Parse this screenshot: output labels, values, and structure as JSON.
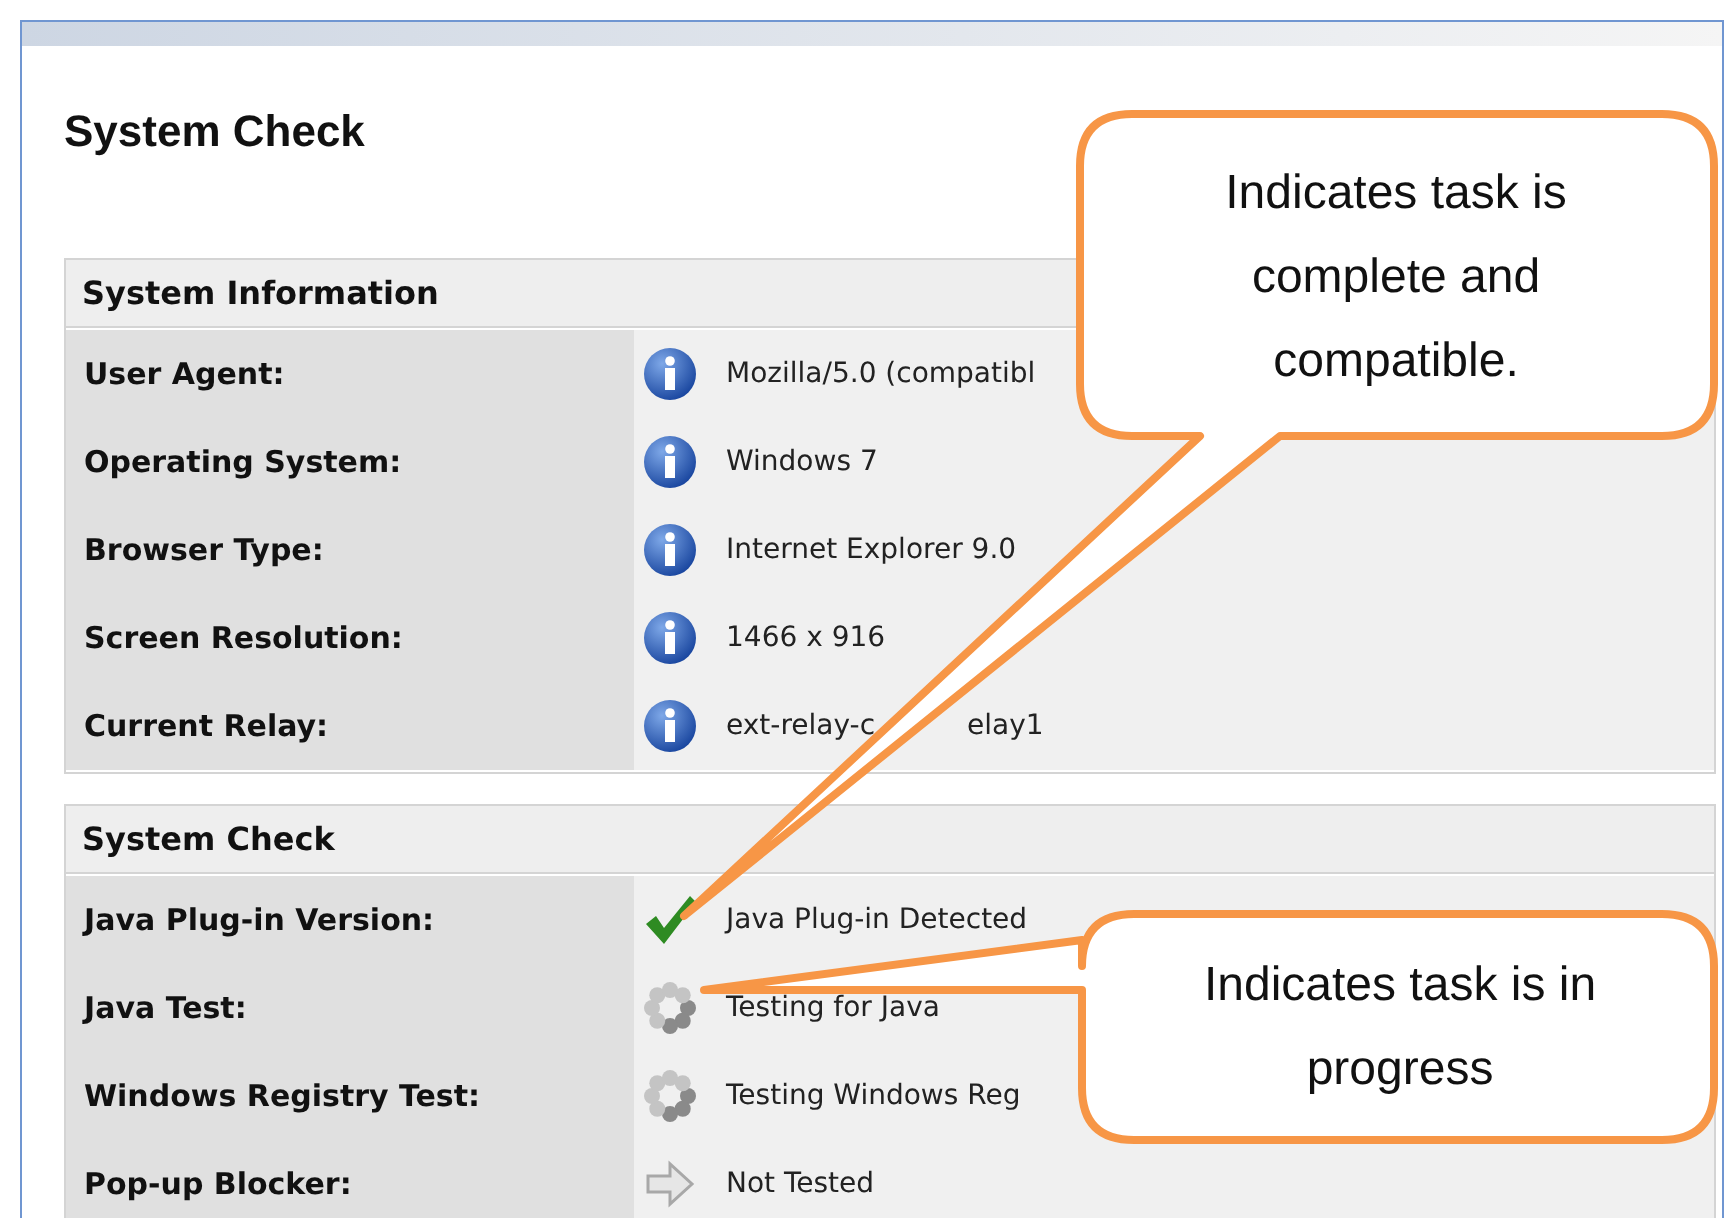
{
  "page": {
    "title": "System Check"
  },
  "sections": [
    {
      "heading": "System Information",
      "rows": [
        {
          "label": "User Agent:",
          "kind": "info",
          "value": "Mozilla/5.0 (compatibl"
        },
        {
          "label": "Operating System:",
          "kind": "info",
          "value": "Windows 7"
        },
        {
          "label": "Browser Type:",
          "kind": "info",
          "value": "Internet Explorer 9.0"
        },
        {
          "label": "Screen Resolution:",
          "kind": "info",
          "value": "1466 x 916"
        },
        {
          "label": "Current Relay:",
          "kind": "info",
          "value": "ext-relay-c",
          "value_after_leader": "elay1"
        }
      ]
    },
    {
      "heading": "System Check",
      "rows": [
        {
          "label": "Java Plug-in Version:",
          "kind": "passed",
          "value": "Java Plug-in Detected"
        },
        {
          "label": "Java Test:",
          "kind": "progress",
          "value": "Testing for Java"
        },
        {
          "label": "Windows Registry Test:",
          "kind": "progress",
          "value": "Testing Windows Reg"
        },
        {
          "label": "Pop-up Blocker:",
          "kind": "untested",
          "value": "Not Tested"
        }
      ]
    }
  ],
  "callouts": [
    {
      "text": "Indicates task is complete and compatible."
    },
    {
      "text": "Indicates task is in progress"
    }
  ]
}
